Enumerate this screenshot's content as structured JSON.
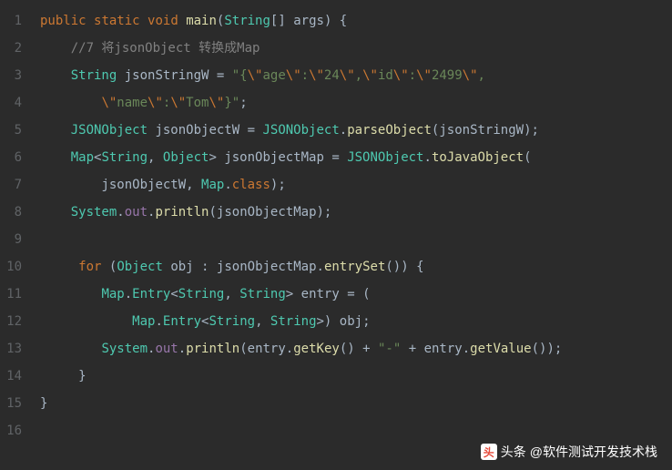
{
  "lineCount": 16,
  "tokens": {
    "public": "public",
    "static": "static",
    "void": "void",
    "main": "main",
    "String": "String",
    "args": "args",
    "comment_7": "//7 将jsonObject 转换成Map",
    "jsonStringW": "jsonStringW",
    "str_part1a": "\"{",
    "str_part1b": "age",
    "str_part1c": ":",
    "str_part1d": "24",
    "str_part1e": ",",
    "str_part1f": "id",
    "str_part1g": ":",
    "str_part1h": "2499",
    "str_part1i": ",",
    "str_part2a": "name",
    "str_part2b": ":",
    "str_part2c": "Tom",
    "str_part2d": "}\"",
    "bs_quote": "\\\"",
    "JSONObject": "JSONObject",
    "jsonObjectW": "jsonObjectW",
    "parseObject": "parseObject",
    "Map": "Map",
    "Object": "Object",
    "jsonObjectMap": "jsonObjectMap",
    "toJavaObject": "toJavaObject",
    "class": "class",
    "System": "System",
    "out": "out",
    "println": "println",
    "for": "for",
    "obj": "obj",
    "entrySet": "entrySet",
    "Entry": "Entry",
    "entry": "entry",
    "getKey": "getKey",
    "getValue": "getValue",
    "dash_str": "\"-\""
  },
  "watermark": {
    "prefix": "头条",
    "handle": "@软件测试开发技术栈"
  }
}
